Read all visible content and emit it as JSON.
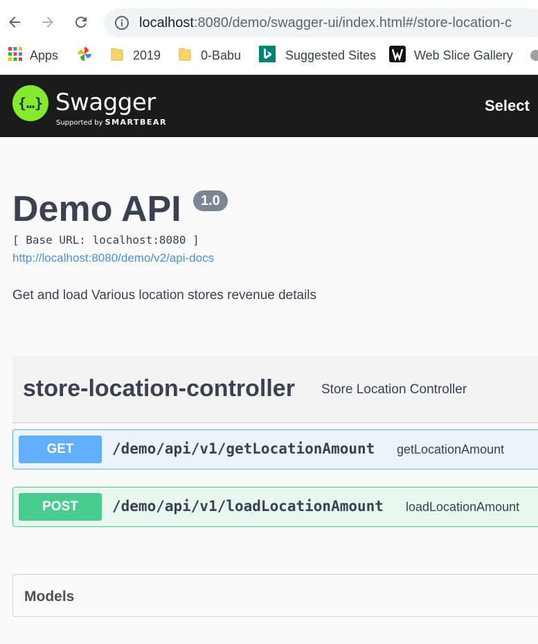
{
  "browser": {
    "url_host": "localhost",
    "url_rest": ":8080/demo/swagger-ui/index.html#/store-location-c",
    "icons": {
      "back": "back-arrow-icon",
      "forward": "forward-arrow-icon",
      "reload": "reload-icon",
      "info": "info-icon"
    },
    "bookmarks": [
      {
        "label": "Apps",
        "icon": "apps-grid-icon"
      },
      {
        "label": "",
        "icon": "pinwheel-icon"
      },
      {
        "label": "2019",
        "icon": "folder-icon"
      },
      {
        "label": "0-Babu",
        "icon": "folder-icon"
      },
      {
        "label": "Suggested Sites",
        "icon": "bing-icon"
      },
      {
        "label": "Web Slice Gallery",
        "icon": "web-slice-icon"
      }
    ]
  },
  "topbar": {
    "logo_glyph": "{…}",
    "logo_text": "Swagger",
    "logo_sub_prefix": "Supported by",
    "logo_sub_brand": "SMARTBEAR",
    "select_label": "Select"
  },
  "info": {
    "title": "Demo API",
    "version": "1.0",
    "base_url": "[ Base URL: localhost:8080 ]",
    "docs_link": "http://localhost:8080/demo/v2/api-docs",
    "description": "Get and load Various location stores revenue details"
  },
  "tag": {
    "name": "store-location-controller",
    "description": "Store Location Controller"
  },
  "operations": [
    {
      "method": "GET",
      "path": "/demo/api/v1/getLocationAmount",
      "summary": "getLocationAmount"
    },
    {
      "method": "POST",
      "path": "/demo/api/v1/loadLocationAmount",
      "summary": "loadLocationAmount"
    }
  ],
  "models": {
    "title": "Models"
  },
  "colors": {
    "get": "#61affe",
    "post": "#49cc90",
    "topbar": "#1b1b1b",
    "logo": "#85ea2d",
    "link": "#4990e2"
  }
}
